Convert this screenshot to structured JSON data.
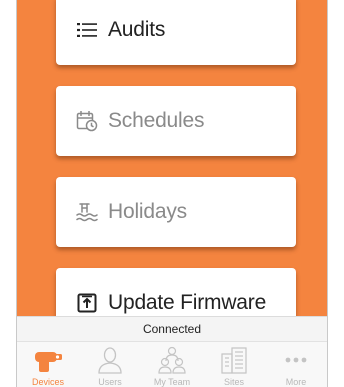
{
  "menu": {
    "items": [
      {
        "label": "Audits",
        "icon": "list-icon",
        "enabled": true
      },
      {
        "label": "Schedules",
        "icon": "calendar-clock-icon",
        "enabled": false
      },
      {
        "label": "Holidays",
        "icon": "beach-icon",
        "enabled": false
      },
      {
        "label": "Update Firmware",
        "icon": "upload-icon",
        "enabled": true
      }
    ]
  },
  "status": {
    "text": "Connected"
  },
  "tabs": [
    {
      "label": "Devices",
      "icon": "devices-icon",
      "active": true
    },
    {
      "label": "Users",
      "icon": "user-icon",
      "active": false
    },
    {
      "label": "My Team",
      "icon": "team-icon",
      "active": false
    },
    {
      "label": "Sites",
      "icon": "building-icon",
      "active": false
    },
    {
      "label": "More",
      "icon": "more-dots-icon",
      "active": false
    }
  ],
  "colors": {
    "accent": "#f4843f",
    "inactive": "#b8b8b8"
  }
}
